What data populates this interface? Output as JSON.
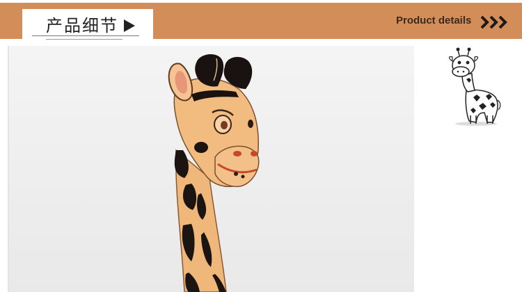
{
  "header": {
    "title_cn": "产品细节",
    "subtitle_en": "Product details",
    "colors": {
      "band": "#d38d58",
      "tab": "#ffffff",
      "text": "#222222"
    }
  },
  "icons": {
    "tab_arrow": "play-triangle-icon",
    "header_arrows": "triple-chevron-right-icon",
    "mascot": "giraffe-cartoon-icon"
  },
  "photo": {
    "subject": "",
    "colors": {
      "body": "#f0b77a",
      "spots": "#1c1410",
      "background": "#efefef"
    }
  }
}
